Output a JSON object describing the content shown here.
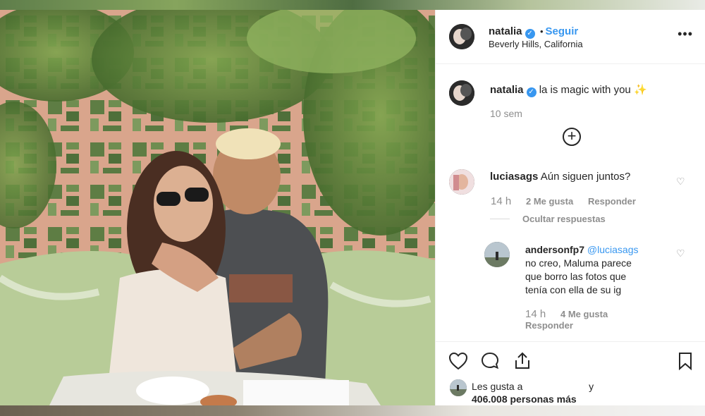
{
  "header": {
    "username": "natalia",
    "follow_label": "Seguir",
    "separator": "•",
    "location": "Beverly Hills, California",
    "more_icon": "more-horizontal-icon"
  },
  "caption": {
    "username": "natalia",
    "text": "la is magic with you",
    "emoji": "✨",
    "time": "10 sem"
  },
  "comments": [
    {
      "username": "luciasags",
      "text": "Aún siguen juntos?",
      "time": "14 h",
      "likes": "2 Me gusta",
      "reply_label": "Responder",
      "hide_replies": "Ocultar respuestas"
    }
  ],
  "reply": {
    "username": "andersonfp7",
    "mention": "@luciasags",
    "line1": "no creo, Maluma parece",
    "line2": "que borro las fotos que",
    "line3": "tenía con ella de su ig",
    "time": "14 h",
    "likes": "4 Me gusta",
    "reply_label": "Responder"
  },
  "actions": {
    "liked_by_prefix": "Les gusta a",
    "liked_by_suffix": "y",
    "likes_count": "406.008 personas más"
  },
  "colors": {
    "accent": "#3897f0",
    "text": "#262626",
    "muted": "#8e8e8e"
  }
}
